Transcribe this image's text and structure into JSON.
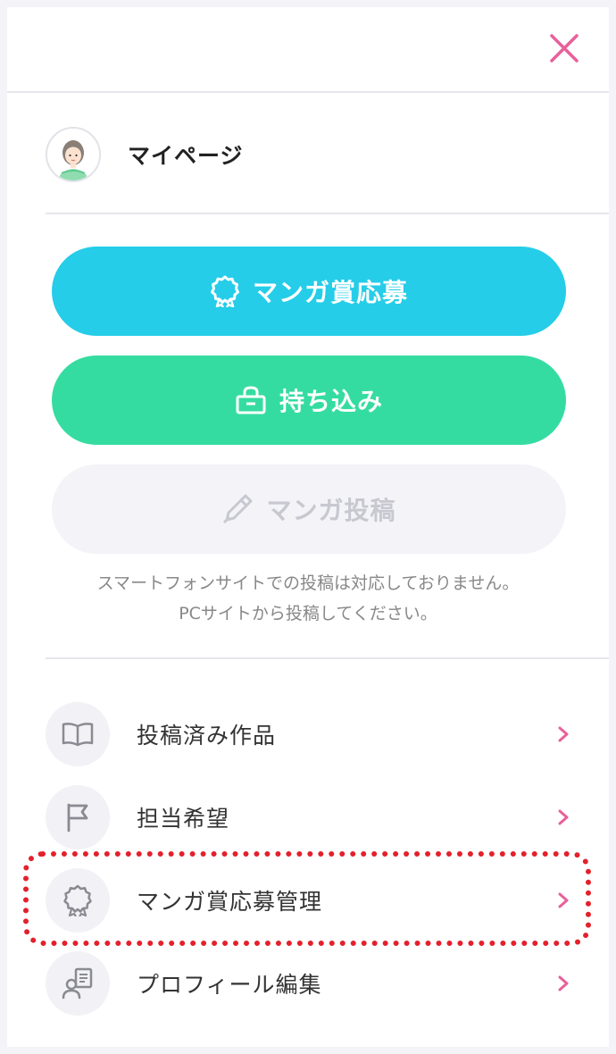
{
  "header": {
    "close_icon": "close-icon"
  },
  "mypage": {
    "label": "マイページ",
    "avatar_icon": "user-avatar"
  },
  "buttons": {
    "contest": {
      "label": "マンガ賞応募",
      "icon": "award-icon",
      "color": "#25cde8"
    },
    "bring": {
      "label": "持ち込み",
      "icon": "bag-icon",
      "color": "#35dca2"
    },
    "post": {
      "label": "マンガ投稿",
      "icon": "pen-icon",
      "color": "#f3f3f8"
    }
  },
  "note": {
    "line1": "スマートフォンサイトでの投稿は対応しておりません。",
    "line2": "PCサイトから投稿してください。"
  },
  "menu": [
    {
      "label": "投稿済み作品",
      "icon": "book-icon"
    },
    {
      "label": "担当希望",
      "icon": "flag-icon"
    },
    {
      "label": "マンガ賞応募管理",
      "icon": "award-icon"
    },
    {
      "label": "プロフィール編集",
      "icon": "profile-edit-icon"
    }
  ],
  "colors": {
    "accent": "#e8609a",
    "highlight": "#e3202b"
  }
}
